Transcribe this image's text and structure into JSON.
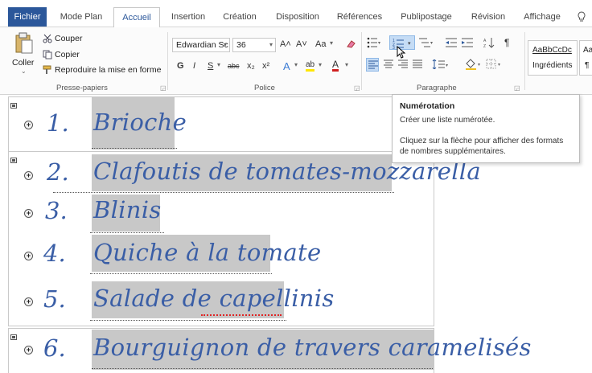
{
  "tabs": [
    "Fichier",
    "Mode Plan",
    "Accueil",
    "Insertion",
    "Création",
    "Disposition",
    "Références",
    "Publipostage",
    "Révision",
    "Affichage"
  ],
  "active_tab": "Accueil",
  "clipboard": {
    "paste_label": "Coller",
    "cut_label": "Couper",
    "copy_label": "Copier",
    "format_painter_label": "Reproduire la mise en forme",
    "group_label": "Presse-papiers"
  },
  "font": {
    "name_value": "Edwardian Sc",
    "size_value": "36",
    "grow_label": "A˄",
    "shrink_label": "A˅",
    "case_label": "Aa",
    "bold_label": "G",
    "italic_label": "I",
    "underline_label": "S",
    "strike_label": "abc",
    "subscript_label": "x₂",
    "superscript_label": "x²",
    "effects_label": "A",
    "highlight_label": "ab",
    "color_label": "A",
    "group_label": "Police"
  },
  "paragraph": {
    "group_label": "Paragraphe",
    "pilcrow": "¶"
  },
  "styles": {
    "style1_sample": "AaBbCcDc",
    "style1_name": "Ingrédients",
    "style2_sample": "Aa",
    "style2_name": "¶"
  },
  "tooltip": {
    "title": "Numérotation",
    "line1": "Créer une liste numérotée.",
    "line2": "Cliquez sur la flèche pour afficher des formats",
    "line3": "de nombres supplémentaires."
  },
  "recipes": [
    {
      "num": "1.",
      "title": "Brioche"
    },
    {
      "num": "2.",
      "title": "Clafoutis de tomates-mozzarella"
    },
    {
      "num": "3.",
      "title": "Blinis"
    },
    {
      "num": "4.",
      "title": "Quiche à la tomate"
    },
    {
      "num": "5.",
      "title": "Salade de capellinis"
    },
    {
      "num": "6.",
      "title": "Bourguignon de travers caramelisés"
    }
  ],
  "colors": {
    "file_tab": "#2b579a",
    "accent": "#2b579a",
    "heading_text": "#3a5ea6",
    "selection": "#c8c8c8"
  }
}
